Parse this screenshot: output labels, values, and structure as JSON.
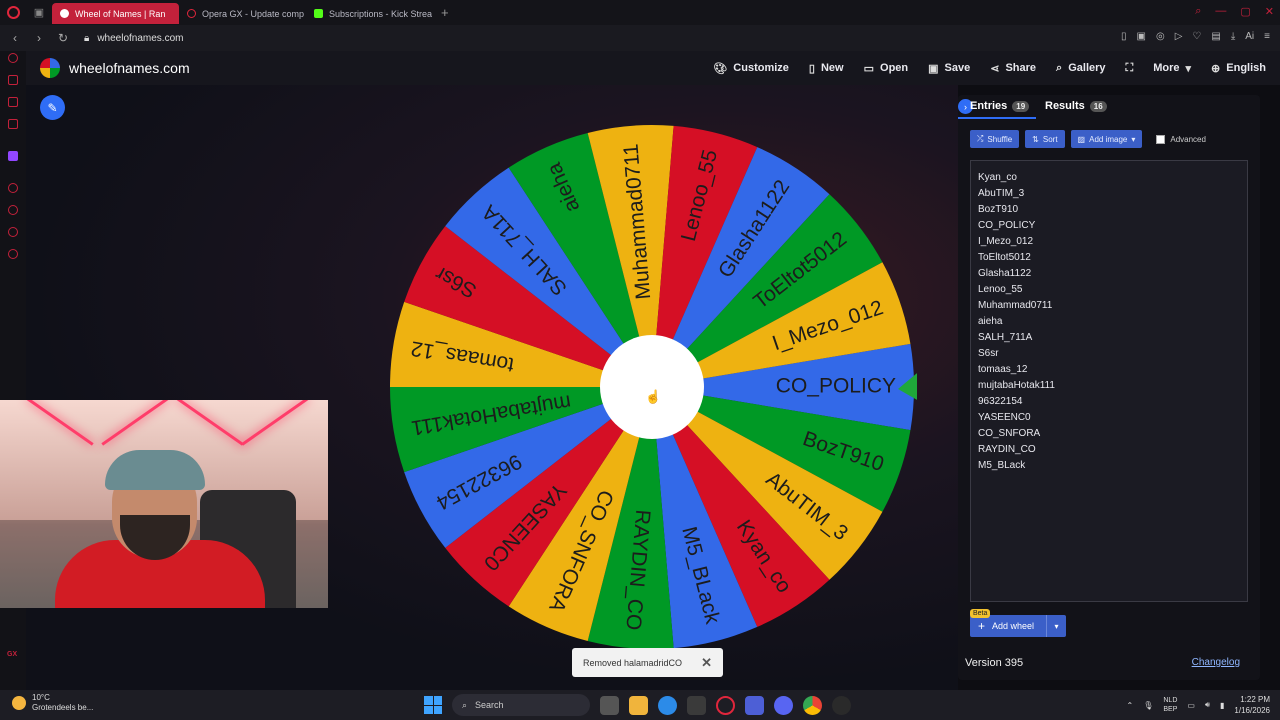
{
  "browser": {
    "tabs": [
      {
        "label": "Wheel of Names | Ran",
        "active": true,
        "color": "#c3213b"
      },
      {
        "label": "Opera GX - Update comp",
        "active": false,
        "color": "#e0263c"
      },
      {
        "label": "Subscriptions - Kick Strea",
        "active": false,
        "color": "#53fc18"
      }
    ],
    "url": "wheelofnames.com"
  },
  "site": {
    "title": "wheelofnames.com",
    "menu": [
      {
        "icon": "palette-icon",
        "label": "Customize"
      },
      {
        "icon": "new-file-icon",
        "label": "New"
      },
      {
        "icon": "folder-icon",
        "label": "Open"
      },
      {
        "icon": "save-icon",
        "label": "Save"
      },
      {
        "icon": "share-icon",
        "label": "Share"
      },
      {
        "icon": "search-icon",
        "label": "Gallery"
      },
      {
        "icon": "fullscreen-icon",
        "label": ""
      },
      {
        "icon": "chevron-down-icon",
        "label": "More"
      },
      {
        "icon": "globe-icon",
        "label": "English"
      }
    ]
  },
  "wheel": {
    "colors": [
      "#3369e8",
      "#009925",
      "#eeb211",
      "#d50f25"
    ],
    "pointer_color": "#1fa83a",
    "slices": [
      "CO_POLICY",
      "BozT910",
      "AbuTIM_3",
      "Kyan_co",
      "M5_BLack",
      "RAYDIN_CO",
      "CO_SNFORA",
      "YASEENC0",
      "96322154",
      "mujtabaHotak111",
      "tomaas_12",
      "S6sr",
      "SALH_711A",
      "aieha",
      "Muhammad0711",
      "Lenoo_55",
      "Glasha1122",
      "ToEltot5012",
      "I_Mezo_012"
    ]
  },
  "toast": {
    "text": "Removed halamadridCO",
    "close": "✕"
  },
  "panel": {
    "tabs": {
      "entries_label": "Entries",
      "entries_count": "19",
      "results_label": "Results",
      "results_count": "16"
    },
    "toolbar": {
      "shuffle": "Shuffle",
      "sort": "Sort",
      "add_image": "Add image",
      "advanced": "Advanced"
    },
    "entries": [
      "Kyan_co",
      "AbuTIM_3",
      "BozT910",
      "CO_POLICY",
      "I_Mezo_012",
      "ToEltot5012",
      "Glasha1122",
      "Lenoo_55",
      "Muhammad0711",
      "aieha",
      "SALH_711A",
      "S6sr",
      "tomaas_12",
      "mujtabaHotak111",
      "96322154",
      "YASEENC0",
      "CO_SNFORA",
      "RAYDIN_CO",
      "M5_BLack"
    ],
    "beta": "Beta",
    "add_wheel": "Add wheel",
    "version": "Version 395",
    "changelog": "Changelog"
  },
  "taskbar": {
    "weather_temp": "10°C",
    "weather_desc": "Grotendeels be...",
    "search": "Search",
    "lang_top": "NLD",
    "lang_bottom": "BEP",
    "time": "1:22 PM",
    "date": "1/16/2026"
  }
}
